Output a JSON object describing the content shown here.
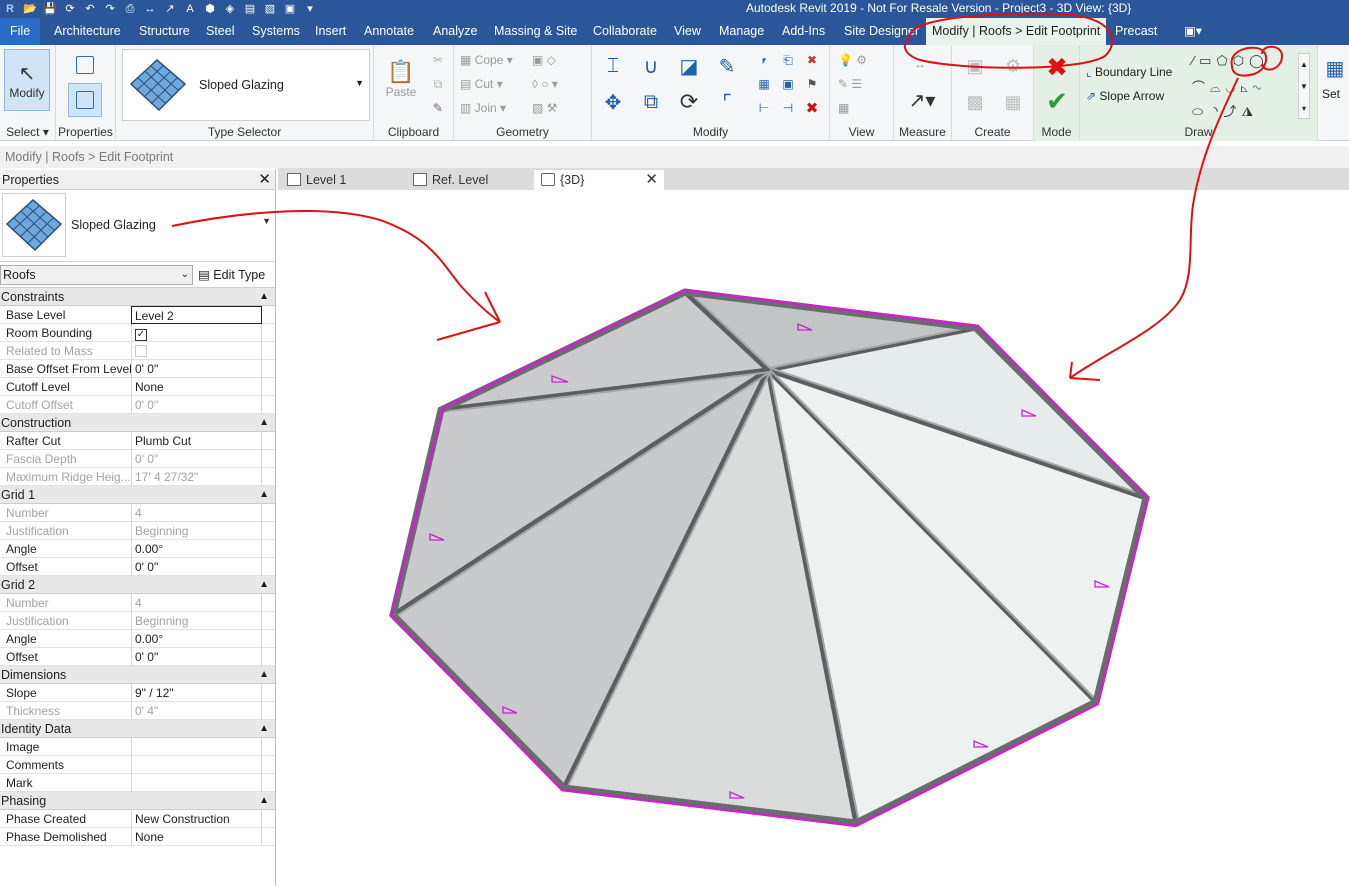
{
  "titlebar": {
    "title": "Autodesk Revit 2019 - Not For Resale Version - Project3 - 3D View: {3D}"
  },
  "menu": {
    "file": "File",
    "tabs": [
      "Architecture",
      "Structure",
      "Steel",
      "Systems",
      "Insert",
      "Annotate",
      "Analyze",
      "Massing & Site",
      "Collaborate",
      "View",
      "Manage",
      "Add-Ins",
      "Site Designer"
    ],
    "context_tab": "Modify | Roofs > Edit Footprint",
    "extra_tab": "Precast"
  },
  "ribbon": {
    "select": {
      "button": "Modify",
      "label": "Select"
    },
    "properties": {
      "label": "Properties"
    },
    "type_selector": {
      "value": "Sloped Glazing",
      "label": "Type Selector"
    },
    "clipboard": {
      "paste": "Paste",
      "label": "Clipboard"
    },
    "geometry": {
      "cope": "Cope",
      "cut": "Cut",
      "join": "Join",
      "label": "Geometry"
    },
    "modify": {
      "label": "Modify"
    },
    "view": {
      "label": "View"
    },
    "measure": {
      "label": "Measure"
    },
    "create": {
      "label": "Create"
    },
    "mode": {
      "label": "Mode"
    },
    "draw": {
      "boundary_line": "Boundary Line",
      "slope_arrow": "Slope Arrow",
      "label": "Draw"
    },
    "set": {
      "label": "Set"
    }
  },
  "statusbar": {
    "text": "Modify | Roofs > Edit Footprint"
  },
  "properties_palette": {
    "title": "Properties",
    "type_name": "Sloped Glazing",
    "category_filter": "Roofs",
    "edit_type": "Edit Type",
    "groups": [
      {
        "name": "Constraints",
        "rows": [
          {
            "key": "Base Level",
            "value": "Level 2",
            "readonly": false,
            "active": true
          },
          {
            "key": "Room Bounding",
            "check": true,
            "readonly": false
          },
          {
            "key": "Related to Mass",
            "check": false,
            "readonly": true
          },
          {
            "key": "Base Offset From Level",
            "value": "0'  0\"",
            "readonly": false
          },
          {
            "key": "Cutoff Level",
            "value": "None",
            "readonly": false
          },
          {
            "key": "Cutoff Offset",
            "value": "0'  0\"",
            "readonly": true
          }
        ]
      },
      {
        "name": "Construction",
        "rows": [
          {
            "key": "Rafter Cut",
            "value": "Plumb Cut",
            "readonly": false
          },
          {
            "key": "Fascia Depth",
            "value": "0'  0\"",
            "readonly": true
          },
          {
            "key": "Maximum Ridge Heig...",
            "value": "17'  4 27/32\"",
            "readonly": true
          }
        ]
      },
      {
        "name": "Grid 1",
        "rows": [
          {
            "key": "Number",
            "value": "4",
            "readonly": true
          },
          {
            "key": "Justification",
            "value": "Beginning",
            "readonly": true
          },
          {
            "key": "Angle",
            "value": "0.00°",
            "readonly": false
          },
          {
            "key": "Offset",
            "value": "0'  0\"",
            "readonly": false
          }
        ]
      },
      {
        "name": "Grid 2",
        "rows": [
          {
            "key": "Number",
            "value": "4",
            "readonly": true
          },
          {
            "key": "Justification",
            "value": "Beginning",
            "readonly": true
          },
          {
            "key": "Angle",
            "value": "0.00°",
            "readonly": false
          },
          {
            "key": "Offset",
            "value": "0'  0\"",
            "readonly": false
          }
        ]
      },
      {
        "name": "Dimensions",
        "rows": [
          {
            "key": "Slope",
            "value": "9\" / 12\"",
            "readonly": false
          },
          {
            "key": "Thickness",
            "value": "0'  4\"",
            "readonly": true
          }
        ]
      },
      {
        "name": "Identity Data",
        "rows": [
          {
            "key": "Image",
            "value": "",
            "readonly": false
          },
          {
            "key": "Comments",
            "value": "",
            "readonly": false
          },
          {
            "key": "Mark",
            "value": "",
            "readonly": false
          }
        ]
      },
      {
        "name": "Phasing",
        "rows": [
          {
            "key": "Phase Created",
            "value": "New Construction",
            "readonly": false
          },
          {
            "key": "Phase Demolished",
            "value": "None",
            "readonly": false
          }
        ]
      }
    ]
  },
  "view_tabs": [
    {
      "label": "Level 1",
      "active": false
    },
    {
      "label": "Ref. Level",
      "active": false
    },
    {
      "label": "{3D}",
      "active": true
    }
  ],
  "colors": {
    "title_bg": "#2b579a",
    "context_tab_bg": "#e9f3ec",
    "footprint_line": "#cc22cc",
    "annotation_red": "#e01010"
  }
}
